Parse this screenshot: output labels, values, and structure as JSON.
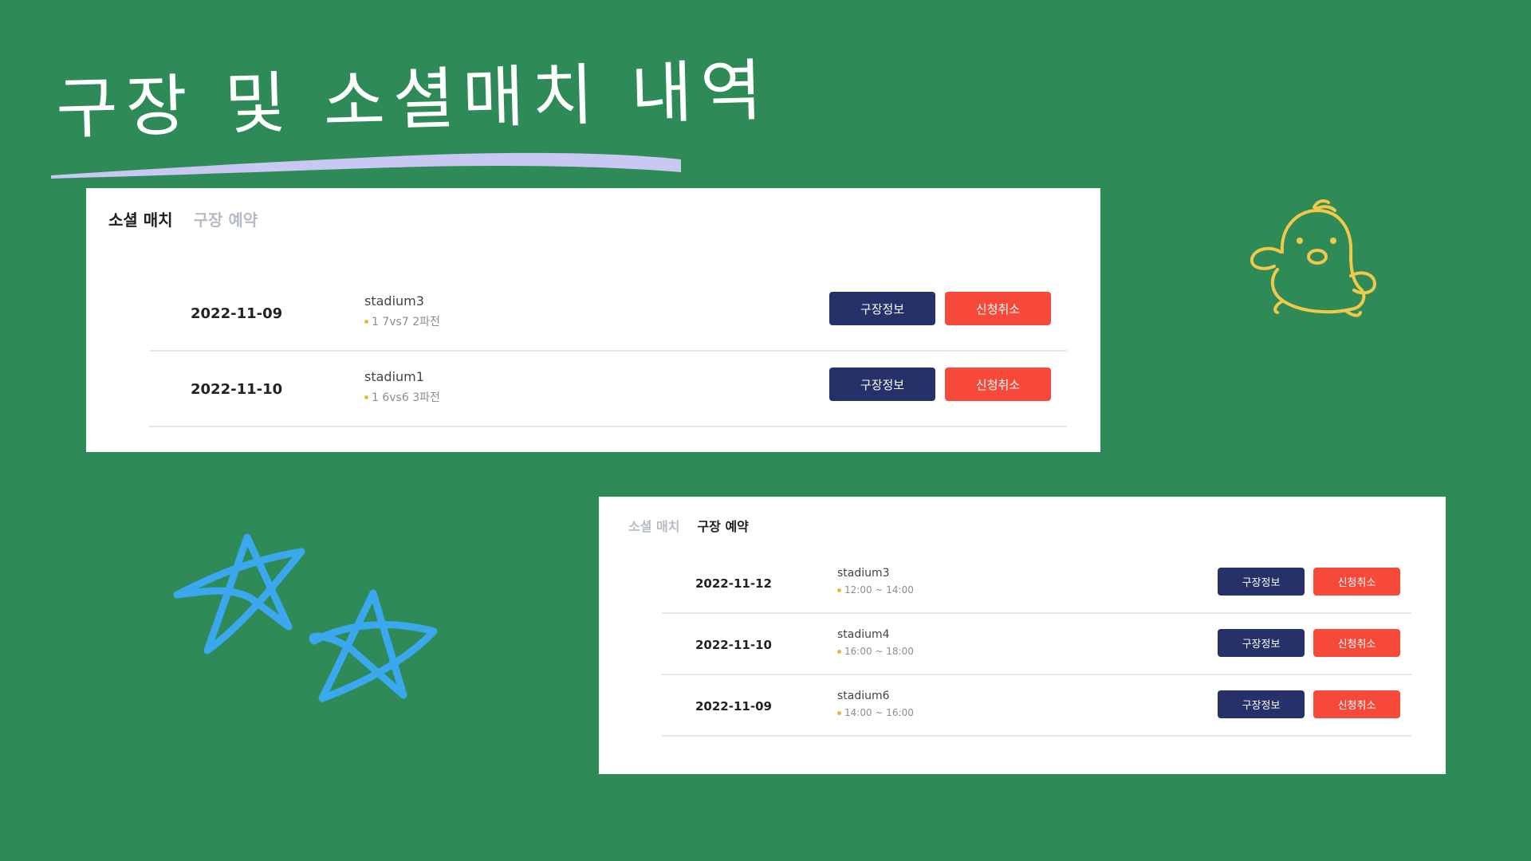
{
  "slide": {
    "title": "구장 및 소셜매치 내역",
    "underline_color": "#c9c8f2",
    "background": "#2e8b57"
  },
  "panel_social": {
    "tabs": [
      {
        "label": "소셜 매치",
        "active": true
      },
      {
        "label": "구장 예약",
        "active": false
      }
    ],
    "rows": [
      {
        "date": "2022-11-09",
        "venue": "stadium3",
        "detail": "1  7vs7  2파전",
        "info_button": "구장정보",
        "cancel_button": "신청취소"
      },
      {
        "date": "2022-11-10",
        "venue": "stadium1",
        "detail": "1  6vs6  3파전",
        "info_button": "구장정보",
        "cancel_button": "신청취소"
      }
    ]
  },
  "panel_reservation": {
    "tabs": [
      {
        "label": "소셜 매치",
        "active": false
      },
      {
        "label": "구장 예약",
        "active": true
      }
    ],
    "rows": [
      {
        "date": "2022-11-12",
        "venue": "stadium3",
        "detail": "12:00 ~ 14:00",
        "info_button": "구장정보",
        "cancel_button": "신청취소"
      },
      {
        "date": "2022-11-10",
        "venue": "stadium4",
        "detail": "16:00 ~ 18:00",
        "info_button": "구장정보",
        "cancel_button": "신청취소"
      },
      {
        "date": "2022-11-09",
        "venue": "stadium6",
        "detail": "14:00 ~ 16:00",
        "info_button": "구장정보",
        "cancel_button": "신청취소"
      }
    ]
  },
  "colors": {
    "info_button": "#263169",
    "cancel_button": "#f6493a",
    "detail_dot": "#f6b52a",
    "chick_stroke": "#f2c84b",
    "star_stroke": "#3aa7ef"
  },
  "decorations": {
    "chick": "chick-doodle-icon",
    "stars": "star-doodle-icon"
  }
}
